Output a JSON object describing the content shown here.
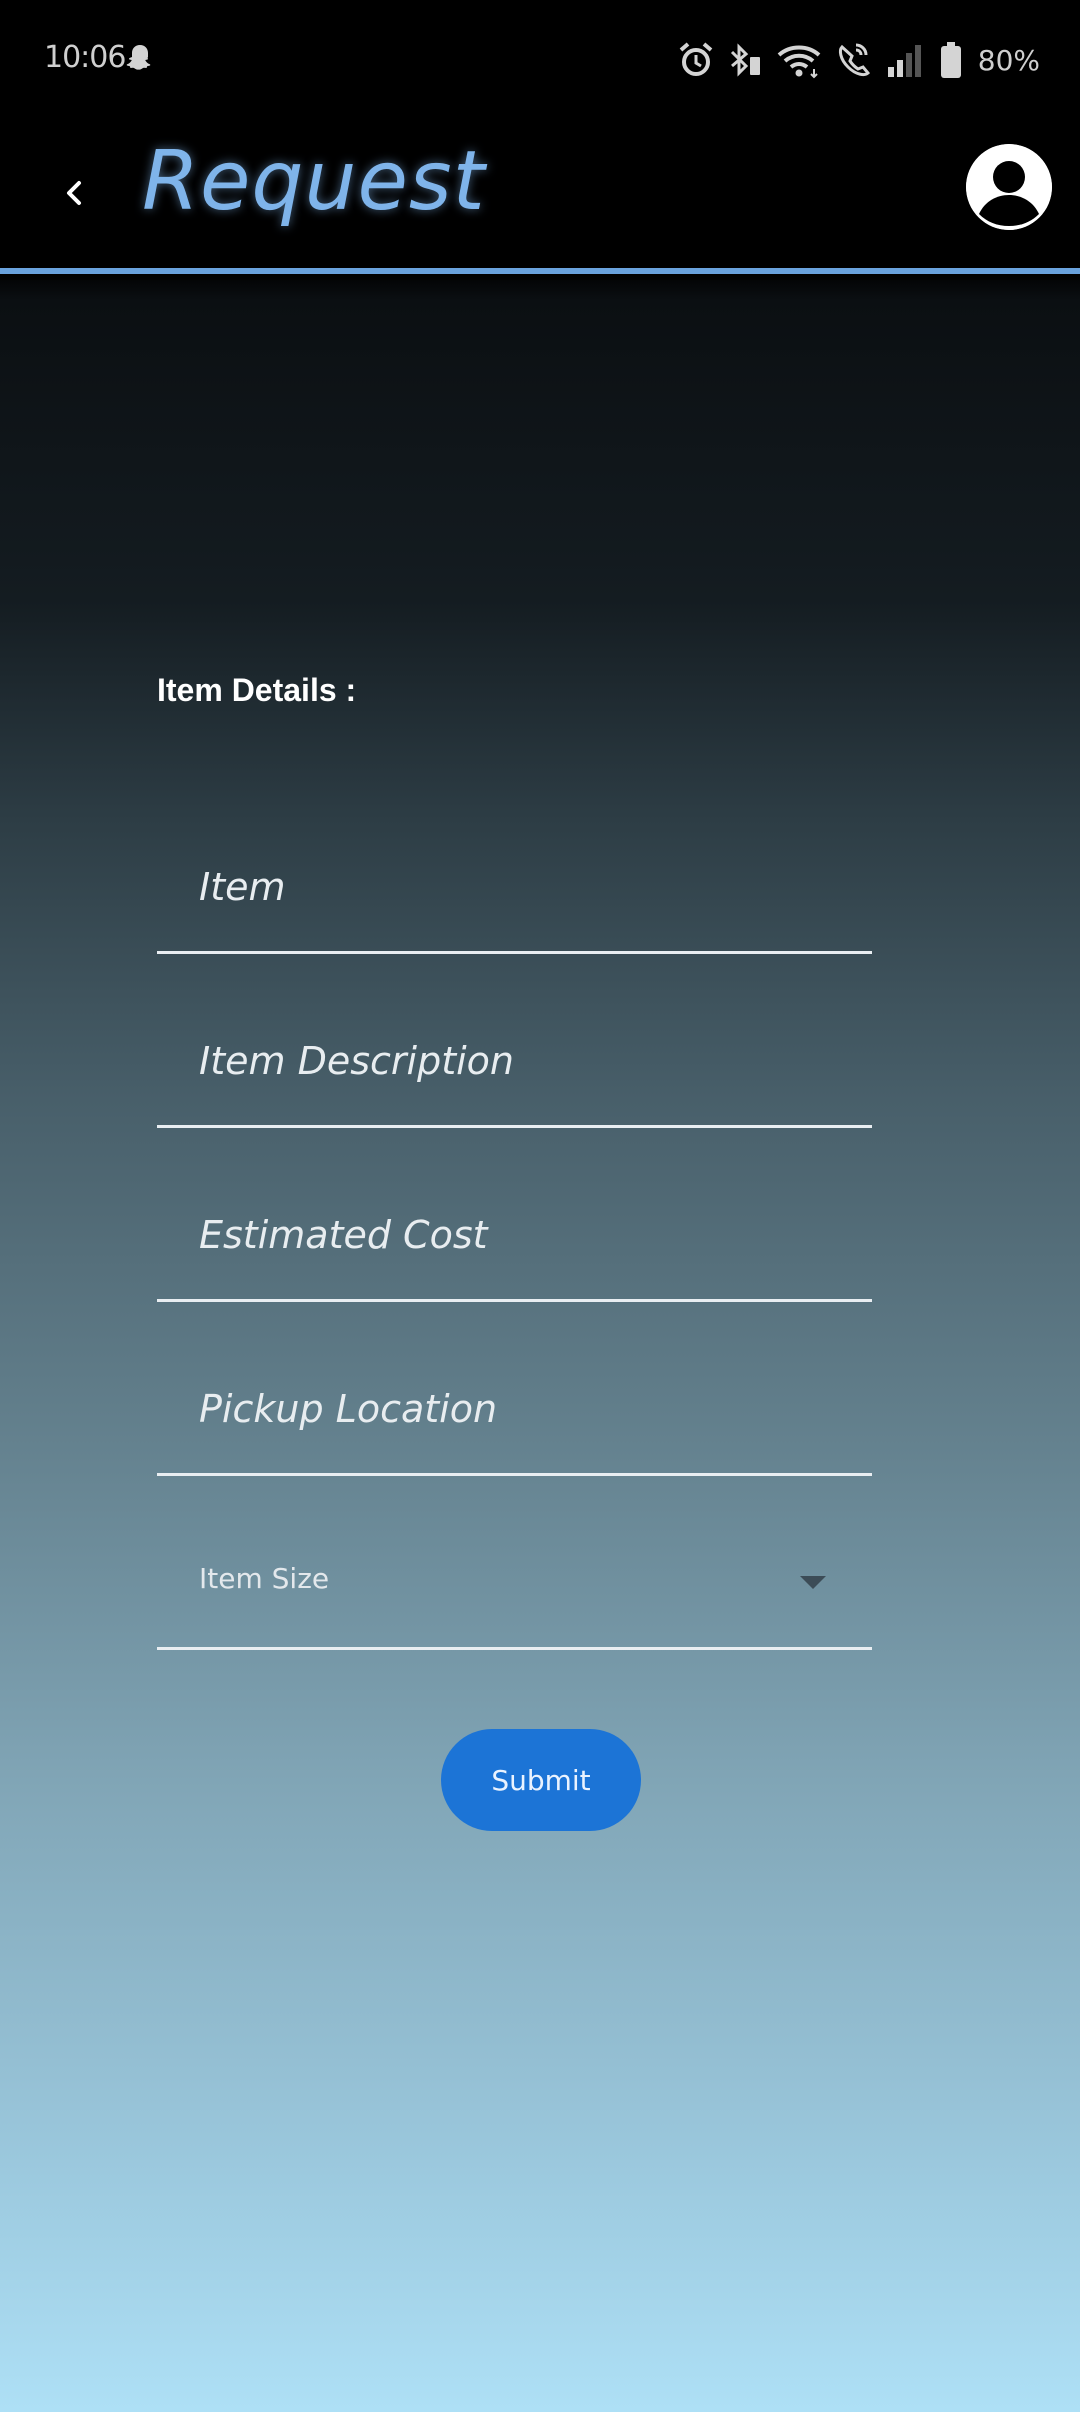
{
  "status_bar": {
    "time": "10:06",
    "battery": "80%",
    "icons": [
      "snapchat-icon",
      "alarm-icon",
      "bluetooth-icon",
      "wifi-icon",
      "wifi-call-icon",
      "signal-icon",
      "battery-icon"
    ]
  },
  "app_bar": {
    "title": "Request",
    "back_icon": "chevron-left-icon",
    "profile_icon": "account-circle-icon",
    "accent_color": "#7fb4ea"
  },
  "form": {
    "section_label": "Item Details :",
    "fields": {
      "item": {
        "placeholder": "Item",
        "value": ""
      },
      "description": {
        "placeholder": "Item Description",
        "value": ""
      },
      "cost": {
        "placeholder": "Estimated Cost",
        "value": ""
      },
      "pickup": {
        "placeholder": "Pickup Location",
        "value": ""
      },
      "size": {
        "placeholder": "Item Size",
        "value": ""
      }
    },
    "submit_label": "Submit",
    "submit_color": "#1c74d6"
  }
}
